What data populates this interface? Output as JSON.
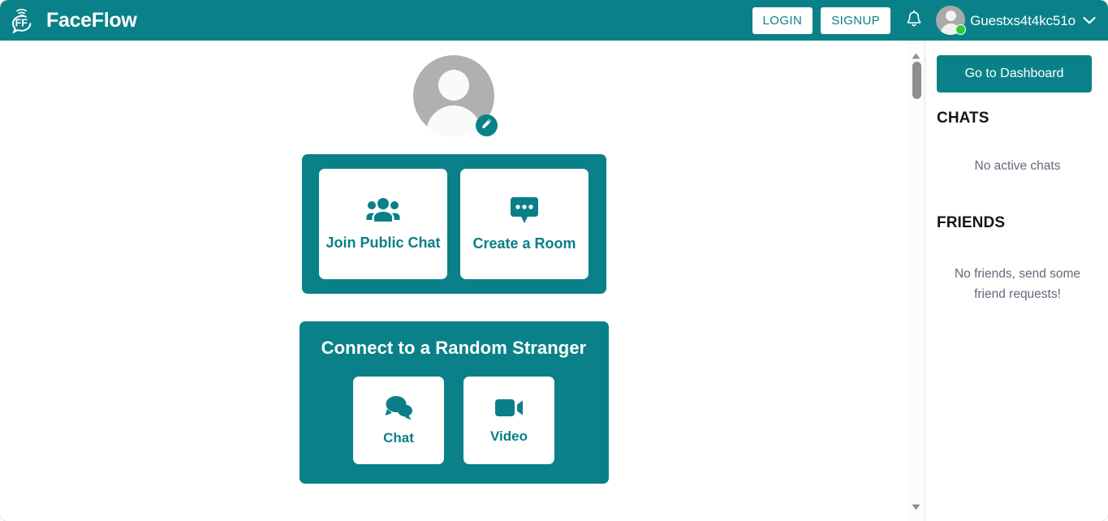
{
  "header": {
    "brand_name": "FaceFlow",
    "brand_logo_icon": "faceflow-logo-icon",
    "login_label": "LOGIN",
    "signup_label": "SIGNUP",
    "notification_icon": "bell-icon",
    "username": "Guestxs4t4kc51o",
    "caret_icon": "chevron-down-icon",
    "avatar_icon": "user-avatar-icon",
    "status": "online"
  },
  "main": {
    "profile": {
      "avatar_icon": "user-avatar-icon",
      "edit_icon": "pencil-icon"
    },
    "rooms_panel": {
      "tiles": [
        {
          "label": "Join Public Chat",
          "icon": "people-group-icon"
        },
        {
          "label": "Create a Room",
          "icon": "speech-bubble-dots-icon"
        }
      ]
    },
    "stranger_panel": {
      "title": "Connect to a Random Stranger",
      "tiles": [
        {
          "label": "Chat",
          "icon": "chat-bubbles-icon"
        },
        {
          "label": "Video",
          "icon": "video-camera-icon"
        }
      ]
    }
  },
  "sidebar": {
    "dashboard_button": "Go to Dashboard",
    "chats_heading": "CHATS",
    "chats_empty": "No active chats",
    "friends_heading": "FRIENDS",
    "friends_empty": "No friends, send some friend requests!"
  },
  "scrollbar": {
    "up_icon": "triangle-up-icon",
    "down_icon": "triangle-down-icon",
    "thumb": "scrollbar-thumb"
  },
  "colors": {
    "brand_teal": "#0a8189",
    "teal_text": "#0a7f87",
    "online_green": "#34c93b",
    "muted_text": "#64697a"
  }
}
